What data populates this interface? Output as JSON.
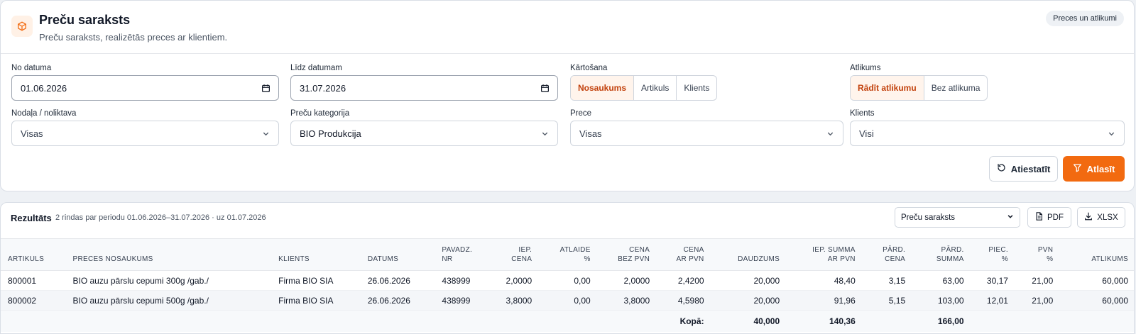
{
  "header": {
    "title": "Preču saraksts",
    "subtitle": "Preču saraksts, realizētās preces ar klientiem.",
    "badge": "Preces un atlikumi"
  },
  "filters": {
    "from_label": "No datuma",
    "from_value": "01.06.2026",
    "to_label": "Līdz datumam",
    "to_value": "31.07.2026",
    "sort_label": "Kārtošana",
    "sort_options": [
      "Nosaukums",
      "Artikuls",
      "Klients"
    ],
    "sort_selected": "Nosaukums",
    "stock_label": "Atlikums",
    "stock_options": [
      "Rādīt atlikumu",
      "Bez atlikuma"
    ],
    "stock_selected": "Rādīt atlikumu",
    "warehouse_label": "Nodaļa / noliktava",
    "warehouse_value": "Visas",
    "category_label": "Preču kategorija",
    "category_value": "BIO Produkcija",
    "product_label": "Prece",
    "product_value": "Visas",
    "client_label": "Klients",
    "client_value": "Visi",
    "reset_label": "Atiestatīt",
    "search_label": "Atlasīt"
  },
  "results": {
    "title": "Rezultāts",
    "meta": "2 rindas par periodu 01.06.2026–31.07.2026 · uz 01.07.2026",
    "report_select": "Preču saraksts",
    "pdf_label": "PDF",
    "xlsx_label": "XLSX",
    "columns": [
      [
        "ARTIKULS"
      ],
      [
        "PRECES NOSAUKUMS"
      ],
      [
        "KLIENTS"
      ],
      [
        "DATUMS"
      ],
      [
        "PAVADZ.",
        "NR"
      ],
      [
        "IEP.",
        "CENA"
      ],
      [
        "ATLAIDE",
        "%"
      ],
      [
        "CENA",
        "BEZ PVN"
      ],
      [
        "CENA",
        "AR PVN"
      ],
      [
        "DAUDZUMS"
      ],
      [
        "IEP. SUMMA",
        "AR PVN"
      ],
      [
        "PĀRD.",
        "CENA"
      ],
      [
        "PĀRD.",
        "SUMMA"
      ],
      [
        "PIEC.",
        "%"
      ],
      [
        "PVN",
        "%"
      ],
      [
        "ATLIKUMS"
      ]
    ],
    "rows": [
      [
        "800001",
        "BIO auzu pārslu cepumi 300g /gab./",
        "Firma BIO SIA",
        "26.06.2026",
        "438999",
        "2,0000",
        "0,00",
        "2,0000",
        "2,4200",
        "20,000",
        "48,40",
        "3,15",
        "63,00",
        "30,17",
        "21,00",
        "60,000"
      ],
      [
        "800002",
        "BIO auzu pārslu cepumi 500g /gab./",
        "Firma BIO SIA",
        "26.06.2026",
        "438999",
        "3,8000",
        "0,00",
        "3,8000",
        "4,5980",
        "20,000",
        "91,96",
        "5,15",
        "103,00",
        "12,01",
        "21,00",
        "60,000"
      ]
    ],
    "totals": {
      "label": "Kopā:",
      "quantity": "40,000",
      "purchase_sum": "140,36",
      "sales_sum": "166,00"
    }
  },
  "colors": {
    "accent": "#f26a10",
    "accent_text": "#c2410c",
    "accent_bg": "#fff4ec"
  }
}
